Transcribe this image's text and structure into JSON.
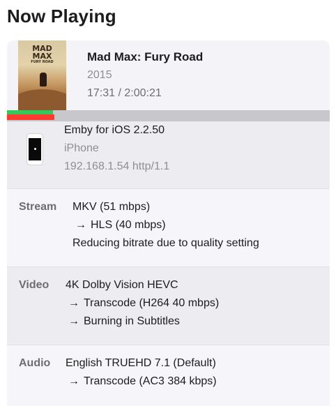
{
  "page": {
    "title": "Now Playing"
  },
  "now_playing": {
    "poster": {
      "title_lines": [
        "MAD",
        "MAX",
        "FURY ROAD"
      ]
    },
    "title": "Mad Max: Fury Road",
    "year": "2015",
    "time": "17:31 / 2:00:21",
    "progress_fraction": 0.146,
    "buffer_fraction": 0.143,
    "colors": {
      "buffer": "#34c759",
      "played": "#ff3b30",
      "track": "#c7c7cc"
    }
  },
  "device": {
    "icon": "iphone-icon",
    "client": "Emby for iOS 2.2.50",
    "name": "iPhone",
    "address": "192.168.1.54 http/1.1"
  },
  "stream": {
    "label": "Stream",
    "lines": [
      "MKV (51 mbps)",
      "HLS (40 mbps)",
      "Reducing bitrate due to quality setting"
    ],
    "arrow": "→"
  },
  "video": {
    "label": "Video",
    "lines": [
      "4K Dolby Vision HEVC",
      "Transcode (H264 40 mbps)",
      "Burning in Subtitles"
    ],
    "arrow": "→"
  },
  "audio": {
    "label": "Audio",
    "lines": [
      "English TRUEHD 7.1 (Default)",
      "Transcode (AC3 384 kbps)"
    ],
    "arrow": "→"
  }
}
